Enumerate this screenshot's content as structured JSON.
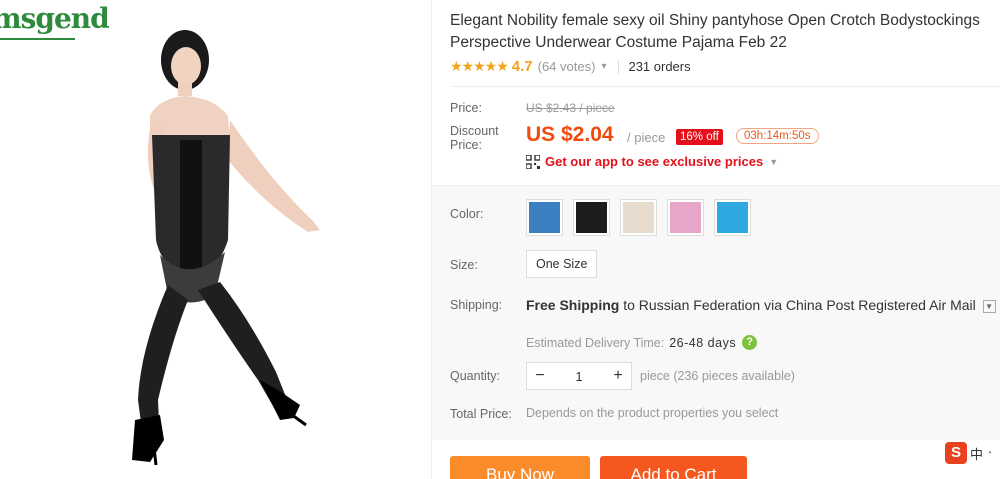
{
  "brand": {
    "text": "msgend"
  },
  "product": {
    "title": "Elegant Nobility female sexy oil Shiny pantyhose Open Crotch Bodystockings Perspective Underwear Costume Pajama Feb 22",
    "stars": "★★★★★",
    "rating": "4.7",
    "votes": "(64 votes)",
    "orders": "231 orders"
  },
  "price": {
    "price_label": "Price:",
    "original": "US $2.43 / piece",
    "discount_label_1": "Discount",
    "discount_label_2": "Price:",
    "current": "US $2.04",
    "unit": "/ piece",
    "off_badge": "16% off",
    "timer": "03h:14m:50s",
    "app_promo": "Get our app to see exclusive prices"
  },
  "options": {
    "color_label": "Color:",
    "color_swatches": [
      "#3a7fbf",
      "#1c1c1c",
      "#e8dccf",
      "#e7a6c9",
      "#2ea9e0"
    ],
    "size_label": "Size:",
    "size_value": "One Size",
    "shipping_label": "Shipping:",
    "shipping_free": "Free Shipping",
    "shipping_to": "to Russian Federation via China Post Registered Air Mail",
    "est_label": "Estimated Delivery Time:",
    "est_days": "26-48 days",
    "quantity_label": "Quantity:",
    "quantity_value": "1",
    "quantity_avail": "piece (236 pieces available)",
    "total_label": "Total Price:",
    "total_note": "Depends on the product properties you select"
  },
  "actions": {
    "buy_now": "Buy Now",
    "add_to_cart": "Add to Cart"
  },
  "ime": {
    "s": "S",
    "zh": "中"
  }
}
